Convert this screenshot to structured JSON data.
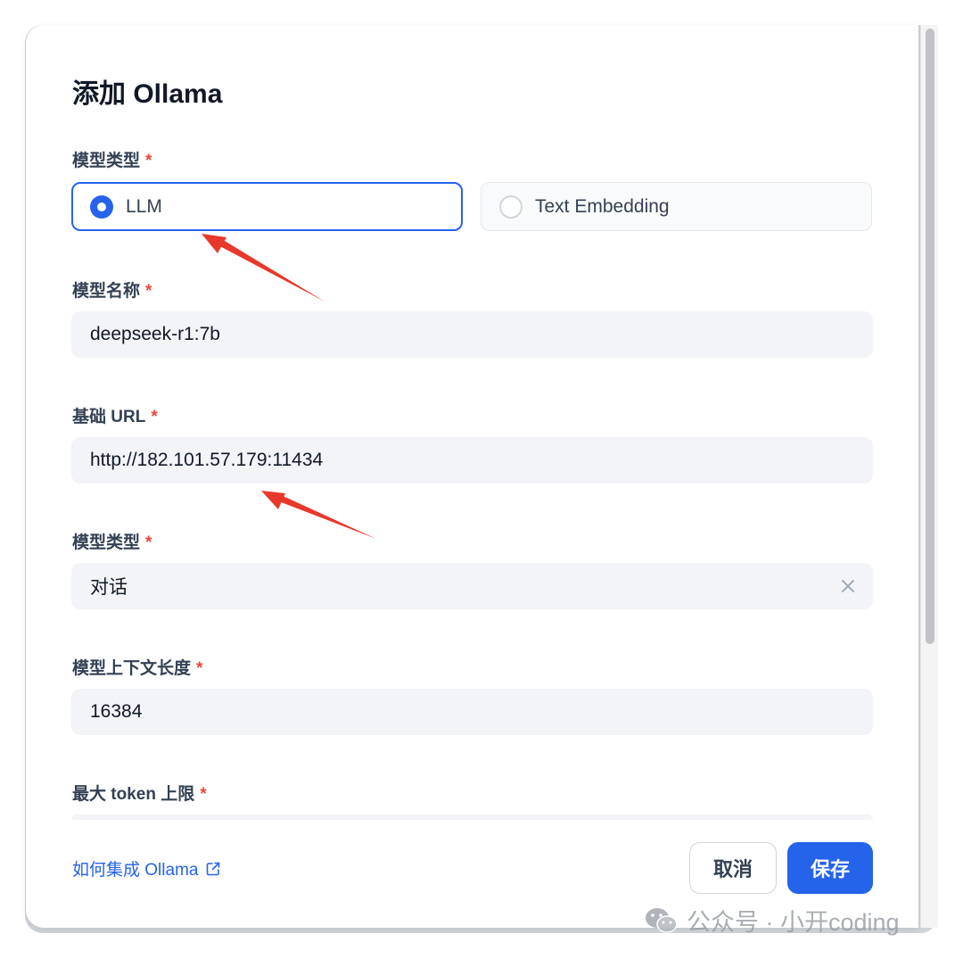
{
  "dialog": {
    "title": "添加 Ollama"
  },
  "model_kind": {
    "label": "模型类型",
    "required": "*",
    "options": [
      {
        "label": "LLM",
        "selected": true
      },
      {
        "label": "Text Embedding",
        "selected": false
      }
    ]
  },
  "model_name": {
    "label": "模型名称",
    "required": "*",
    "value": "deepseek-r1:7b"
  },
  "base_url": {
    "label": "基础 URL",
    "required": "*",
    "value": "http://182.101.57.179:11434"
  },
  "model_type": {
    "label": "模型类型",
    "required": "*",
    "value": "对话",
    "clear_icon": "close-icon"
  },
  "context_length": {
    "label": "模型上下文长度",
    "required": "*",
    "value": "16384"
  },
  "max_tokens": {
    "label": "最大 token 上限",
    "required": "*"
  },
  "footer": {
    "help_link": "如何集成 Ollama",
    "help_icon": "external-link-icon",
    "cancel": "取消",
    "save": "保存"
  },
  "watermark": {
    "text": "公众号 · 小开coding",
    "icon": "wechat-icon"
  },
  "colors": {
    "accent": "#2563eb",
    "required": "#f04438",
    "annotation_arrow": "#e8382b"
  }
}
